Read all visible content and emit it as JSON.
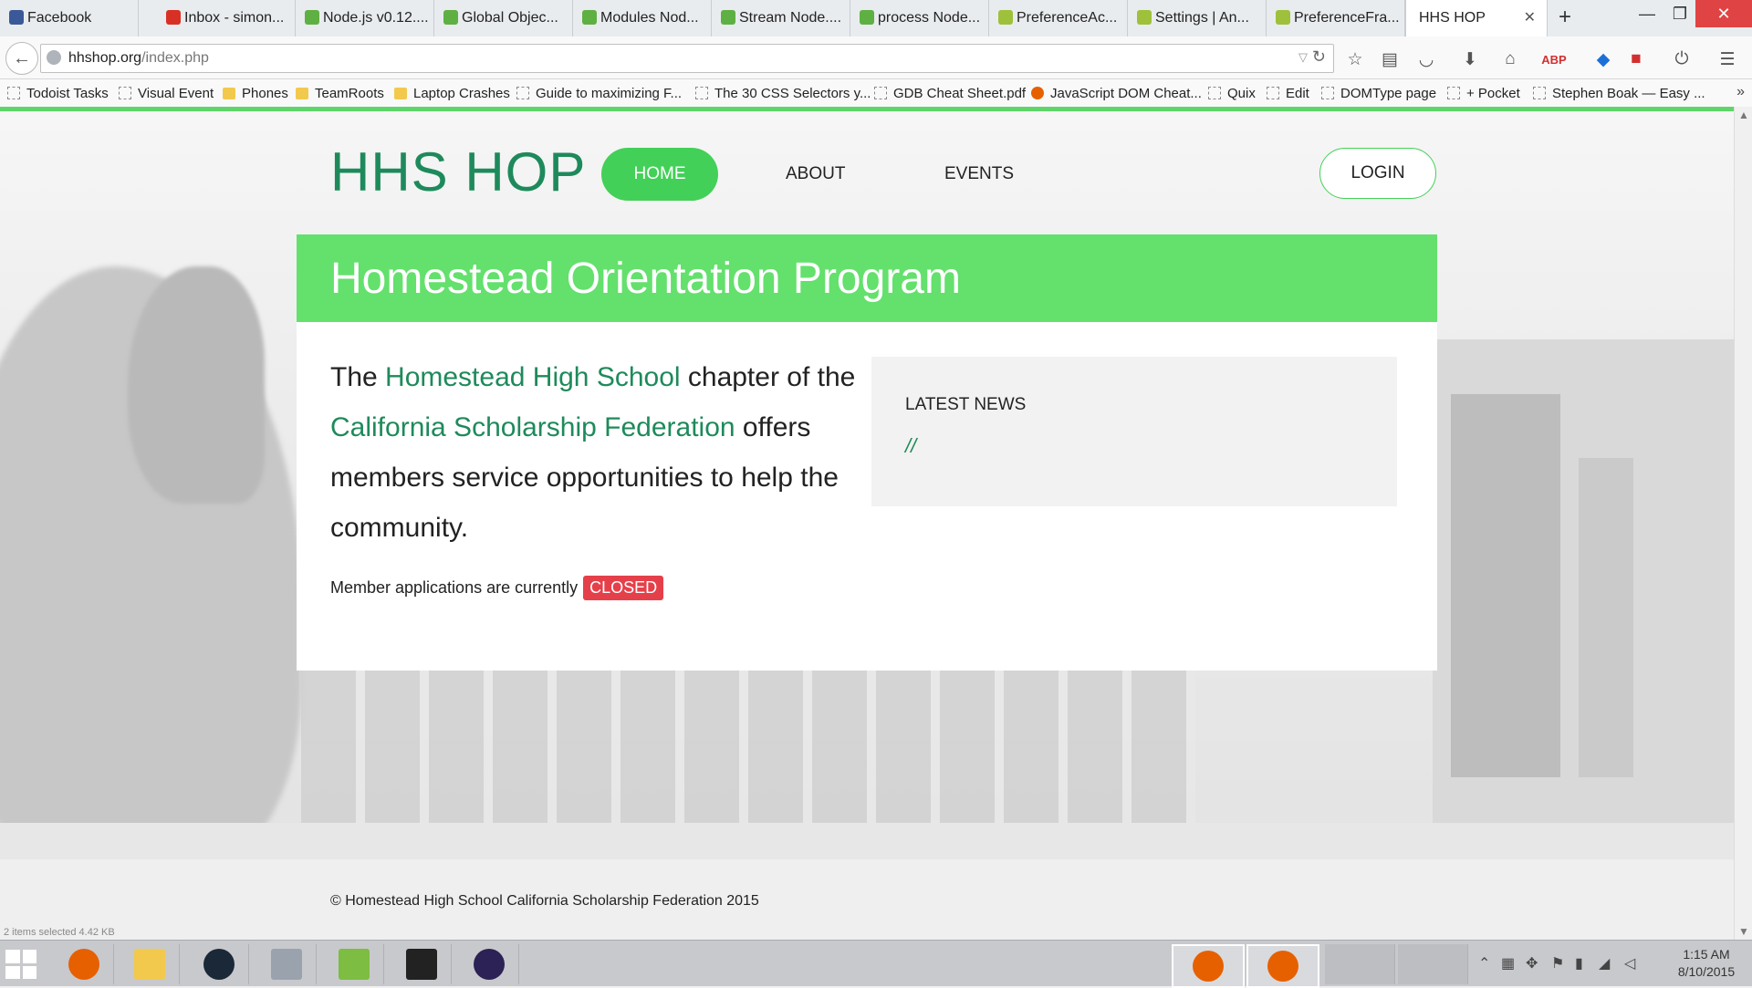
{
  "browser": {
    "tabs": [
      {
        "label": "Facebook",
        "color": "#3b5998"
      },
      {
        "label": "Inbox - simon...",
        "color": "#d93025"
      },
      {
        "label": "Node.js v0.12....",
        "color": "#5fb043"
      },
      {
        "label": "Global Objec...",
        "color": "#5fb043"
      },
      {
        "label": "Modules Nod...",
        "color": "#5fb043"
      },
      {
        "label": "Stream Node....",
        "color": "#5fb043"
      },
      {
        "label": "process Node...",
        "color": "#5fb043"
      },
      {
        "label": "PreferenceAc...",
        "color": "#9fc03b"
      },
      {
        "label": "Settings | An...",
        "color": "#9fc03b"
      },
      {
        "label": "PreferenceFra...",
        "color": "#9fc03b"
      },
      {
        "label": "HHS HOP",
        "color": "#ffffff"
      }
    ],
    "url_host": "hhshop.org",
    "url_path": "/index.php",
    "bookmarks": [
      {
        "label": "Todoist Tasks",
        "icon": "page-icon"
      },
      {
        "label": "Visual Event",
        "icon": "page-icon"
      },
      {
        "label": "Phones",
        "icon": "folder-icon"
      },
      {
        "label": "TeamRoots",
        "icon": "folder-icon"
      },
      {
        "label": "Laptop Crashes",
        "icon": "folder-icon"
      },
      {
        "label": "Guide to maximizing F...",
        "icon": "page-icon"
      },
      {
        "label": "The 30 CSS Selectors y...",
        "icon": "page-icon"
      },
      {
        "label": "GDB Cheat Sheet.pdf",
        "icon": "page-icon"
      },
      {
        "label": "JavaScript DOM Cheat...",
        "icon": "firefox-icon"
      },
      {
        "label": "Quix",
        "icon": "page-icon"
      },
      {
        "label": "Edit",
        "icon": "page-icon"
      },
      {
        "label": "DOMType page",
        "icon": "page-icon"
      },
      {
        "label": "+ Pocket",
        "icon": "page-icon"
      },
      {
        "label": "Stephen Boak — Easy ...",
        "icon": "page-icon"
      }
    ]
  },
  "site": {
    "brand": "HHS HOP",
    "nav": {
      "home": "HOME",
      "about": "ABOUT",
      "events": "EVENTS",
      "login": "LOGIN"
    },
    "banner_title": "Homestead Orientation Program",
    "intro": {
      "p1": "The ",
      "link1": "Homestead High School",
      "p2": " chapter of the ",
      "link2": "California Scholarship Federation",
      "p3": " offers members service opportunities to help the community."
    },
    "applications_text": "Member applications are currently",
    "applications_status": "CLOSED",
    "news_title": "LATEST NEWS",
    "news_body": "//",
    "footer": "© Homestead High School California Scholarship Federation 2015",
    "accent_color": "#43d058",
    "brand_color": "#1e8a5b"
  },
  "taskbar": {
    "status_text": "2 items selected  4.42 KB",
    "time": "1:15 AM",
    "date": "8/10/2015"
  }
}
